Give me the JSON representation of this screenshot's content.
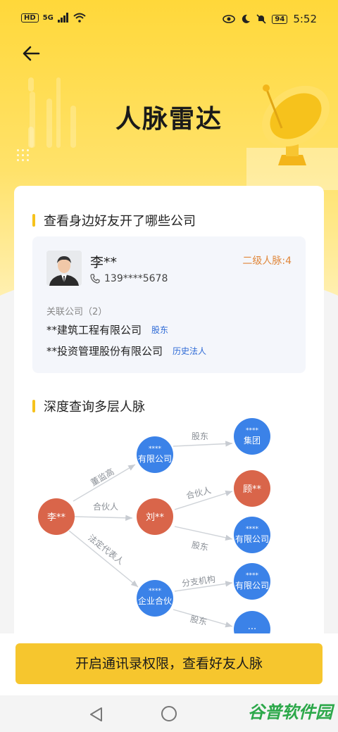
{
  "status": {
    "hd": "HD",
    "net": "5G",
    "battery": "94",
    "time": "5:52"
  },
  "header": {
    "title": "人脉雷达"
  },
  "section1": {
    "title": "查看身边好友开了哪些公司",
    "friend": {
      "name": "李**",
      "phone": "139****5678",
      "level": "二级人脉:4",
      "related_label": "关联公司（2）",
      "companies": [
        {
          "name": "**建筑工程有限公司",
          "tag": "股东"
        },
        {
          "name": "**投资管理股份有限公司",
          "tag": "历史法人"
        }
      ]
    }
  },
  "section2": {
    "title": "深度查询多层人脉",
    "nodes": {
      "li": "李**",
      "co1_top": "****",
      "co1_bottom": "有限公司",
      "liu": "刘**",
      "co2_top": "****",
      "co2_bottom": "企业合伙",
      "group_top": "****",
      "group_bottom": "集团",
      "gu": "顾**",
      "co3_top": "****",
      "co3_bottom": "有限公司",
      "co4_top": "****",
      "co4_bottom": "有限公司",
      "more": "..."
    },
    "edges": {
      "e1": "董监高",
      "e2": "合伙人",
      "e3": "法定代表人",
      "e4": "股东",
      "e5": "合伙人",
      "e6": "股东",
      "e7": "分支机构",
      "e8": "股东"
    },
    "colors": {
      "blue": "#3b82e8",
      "red": "#d9654a"
    }
  },
  "cta": {
    "label": "开启通讯录权限，查看好友人脉"
  },
  "watermark": {
    "text": "谷普软件园"
  }
}
